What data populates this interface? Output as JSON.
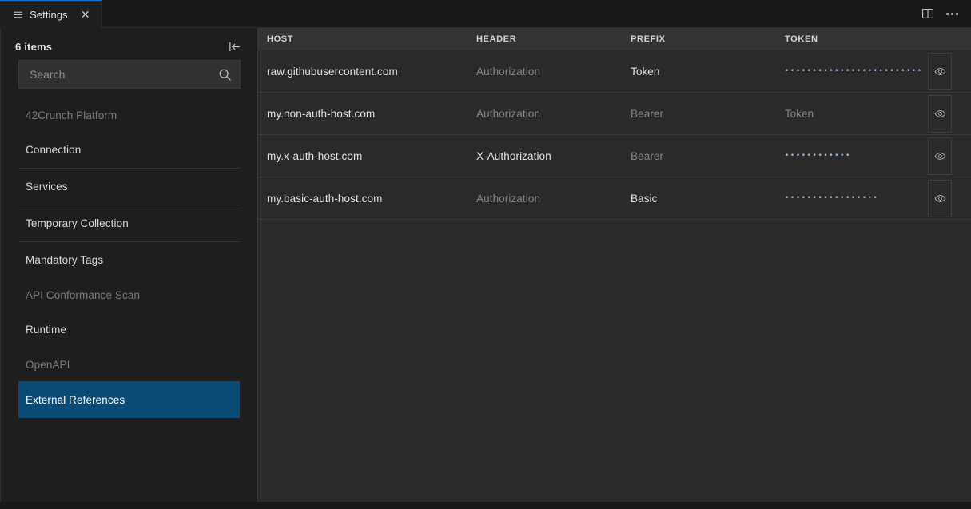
{
  "window": {
    "tab": {
      "icon": "settings-lines-icon",
      "label": "Settings",
      "close_label": "✕"
    },
    "actions": {
      "split_editor_label": "Split Editor",
      "more_actions_label": "More Actions..."
    },
    "accent_color": "#0078d4",
    "background": "#1e1e1e"
  },
  "sidebar": {
    "items_count": "6 items",
    "collapse_label": "Collapse All",
    "search": {
      "value": "",
      "placeholder": "Search",
      "icon": "search-icon"
    },
    "selected_color": "#0a4b76",
    "entries": [
      {
        "label": "42Crunch Platform",
        "type": "section",
        "selected": false
      },
      {
        "label": "Connection",
        "type": "item",
        "selected": false,
        "rule": false
      },
      {
        "label": "Services",
        "type": "item",
        "selected": false,
        "rule": true
      },
      {
        "label": "Temporary Collection",
        "type": "item",
        "selected": false,
        "rule": true
      },
      {
        "label": "Mandatory Tags",
        "type": "item",
        "selected": false,
        "rule": true
      },
      {
        "label": "API Conformance Scan",
        "type": "section",
        "selected": false
      },
      {
        "label": "Runtime",
        "type": "item",
        "selected": false,
        "rule": false
      },
      {
        "label": "OpenAPI",
        "type": "section",
        "selected": false
      },
      {
        "label": "External References",
        "type": "item",
        "selected": true,
        "rule": false
      }
    ]
  },
  "table": {
    "columns": [
      "HOST",
      "HEADER",
      "PREFIX",
      "TOKEN"
    ],
    "reveal_icon": "eye-icon",
    "reveal_label": "Reveal token",
    "rows": [
      {
        "host": "raw.githubusercontent.com",
        "header": "Authorization",
        "header_is_placeholder": true,
        "prefix": "Token",
        "prefix_is_placeholder": false,
        "token": "••••••••••••••••••••••••••••••••••••••••",
        "token_is_placeholder": false
      },
      {
        "host": "my.non-auth-host.com",
        "header": "Authorization",
        "header_is_placeholder": true,
        "prefix": "Bearer",
        "prefix_is_placeholder": true,
        "token": "Token",
        "token_is_placeholder": true
      },
      {
        "host": "my.x-auth-host.com",
        "header": "X-Authorization",
        "header_is_placeholder": false,
        "prefix": "Bearer",
        "prefix_is_placeholder": true,
        "token": "••••••••••••",
        "token_is_placeholder": false
      },
      {
        "host": "my.basic-auth-host.com",
        "header": "Authorization",
        "header_is_placeholder": true,
        "prefix": "Basic",
        "prefix_is_placeholder": false,
        "token": "•••••••••••••••••",
        "token_is_placeholder": false
      }
    ]
  }
}
